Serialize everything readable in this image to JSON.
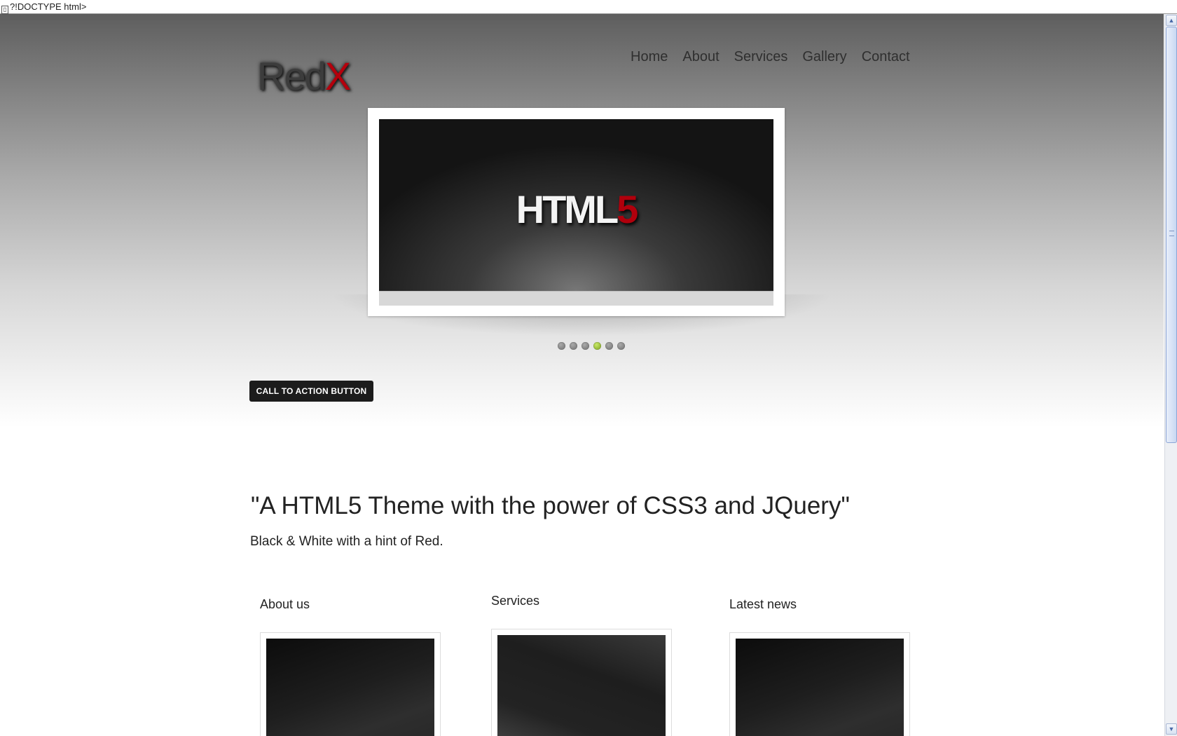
{
  "doctype_text": "?!DOCTYPE html>",
  "logo": {
    "part1": "Red",
    "part2": "X"
  },
  "nav": [
    {
      "label": "Home"
    },
    {
      "label": "About"
    },
    {
      "label": "Services"
    },
    {
      "label": "Gallery"
    },
    {
      "label": "Contact"
    }
  ],
  "slider": {
    "slide_text_main": "HTML",
    "slide_text_accent": "5",
    "dot_count": 6,
    "active_dot": 4
  },
  "cta_label": "CALL TO ACTION BUTTON",
  "tagline": "\"A HTML5 Theme with the power of CSS3 and JQuery\"",
  "subline": "Black & White with a hint of Red.",
  "columns": [
    {
      "title": "About us"
    },
    {
      "title": "Services"
    },
    {
      "title": "Latest news"
    }
  ],
  "colors": {
    "accent": "#b4000c",
    "cta": "#1c1c1c",
    "active_dot": "#9cc43a"
  }
}
